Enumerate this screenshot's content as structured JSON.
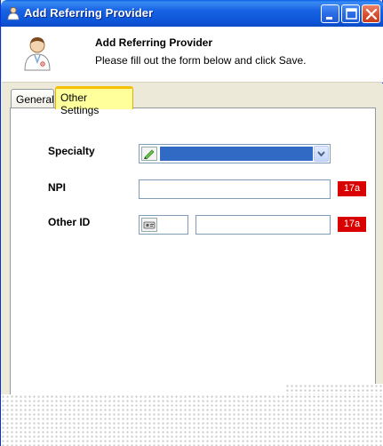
{
  "window": {
    "title": "Add Referring Provider",
    "controls": [
      "minimize-icon",
      "maximize-icon",
      "close-icon"
    ]
  },
  "header": {
    "title": "Add Referring Provider",
    "subtitle": "Please fill out the form below and click Save.",
    "icon": "doctor-icon"
  },
  "tabs": [
    {
      "label": "General",
      "active": false
    },
    {
      "label": "Other Settings",
      "active": true
    }
  ],
  "form": {
    "specialty": {
      "label": "Specialty",
      "value": ""
    },
    "npi": {
      "label": "NPI",
      "value": "",
      "badge": "17a"
    },
    "other_id": {
      "label": "Other ID",
      "value": "",
      "badge": "17a"
    }
  },
  "colors": {
    "titlebar": "#0c53d6",
    "active_tab": "#ffff9c",
    "badge": "#d90000",
    "selection": "#316ac5"
  }
}
